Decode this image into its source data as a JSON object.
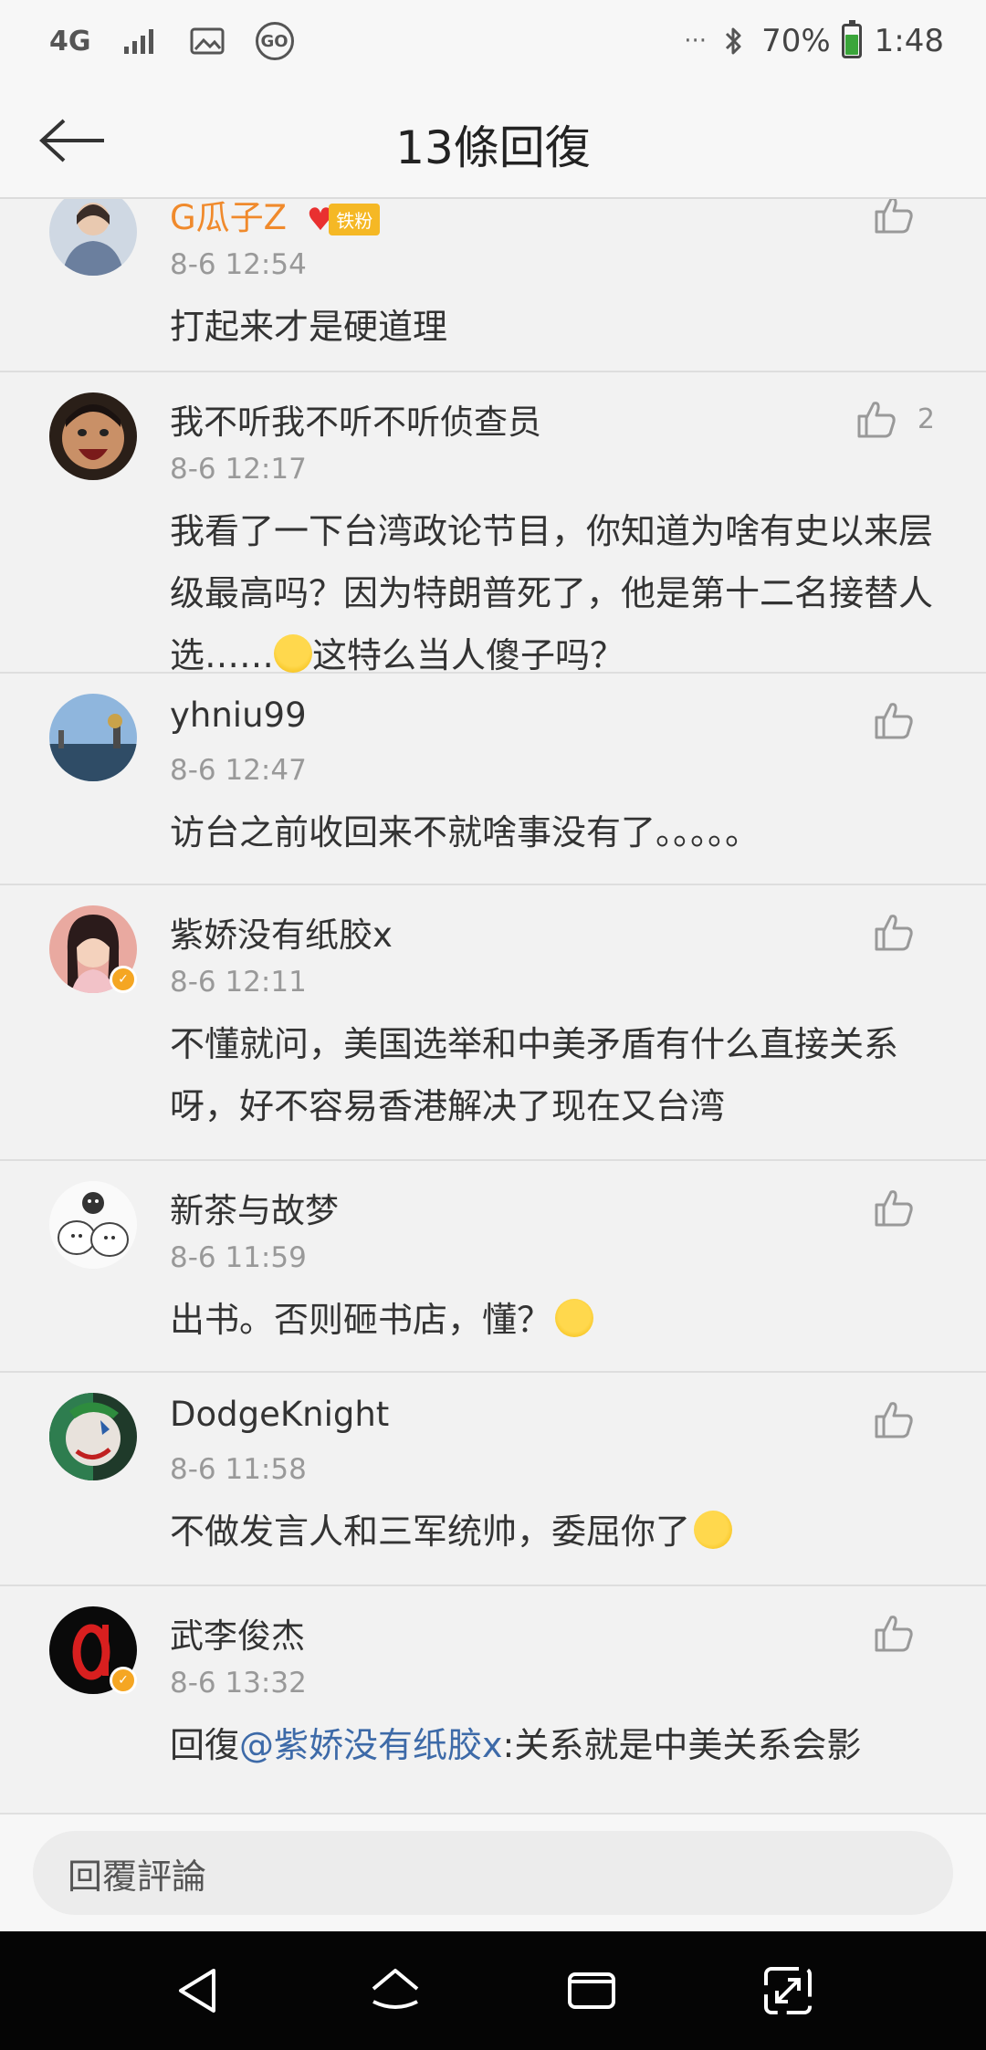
{
  "status_bar": {
    "network": "4G",
    "battery_text": "70%",
    "battery_level": 0.7,
    "time": "1:48",
    "more": "···"
  },
  "header": {
    "title": "13條回復"
  },
  "comments": [
    {
      "username": "G瓜子Z",
      "fan_label": "铁粉",
      "time": "8-6 12:54",
      "text": "打起来才是硬道理",
      "likes": ""
    },
    {
      "username": "我不听我不听不听侦查员",
      "time": "8-6 12:17",
      "text_before": "我看了一下台湾政论节目，你知道为啥有史以来层级最高吗？因为特朗普死了，他是第十二名接替人选……",
      "text_after": "这特么当人傻子吗？",
      "likes": "2"
    },
    {
      "username": "yhniu99",
      "time": "8-6 12:47",
      "text": "访台之前收回来不就啥事没有了。。。。。",
      "likes": ""
    },
    {
      "username": "紫娇没有纸胶x",
      "time": "8-6 12:11",
      "text": "不懂就问，美国选举和中美矛盾有什么直接关系呀，好不容易香港解决了现在又台湾",
      "likes": ""
    },
    {
      "username": "新茶与故梦",
      "time": "8-6 11:59",
      "text": "出书。否则砸书店，懂？",
      "likes": ""
    },
    {
      "username": "DodgeKnight",
      "time": "8-6 11:58",
      "text": "不做发言人和三军统帅，委屈你了",
      "likes": ""
    },
    {
      "username": "武李俊杰",
      "time": "8-6 13:32",
      "reply_prefix": "回復",
      "mention": "@紫娇没有纸胶x",
      "text": ":关系就是中美关系会影",
      "likes": ""
    }
  ],
  "reply_bar": {
    "placeholder": "回覆評論"
  },
  "colors": {
    "background": "#f2f2f2",
    "bar": "#f7f7f7",
    "username_highlight": "#f08a2c",
    "mention": "#3d6aa8",
    "meta": "#999999",
    "nav_bar": "#050505",
    "verified_badge": "#f5a623"
  },
  "icons": {
    "back": "arrow-left-icon",
    "like": "thumbs-up-icon",
    "nav_back": "triangle-back-icon",
    "nav_home": "home-icon",
    "nav_recent": "recent-apps-icon",
    "nav_expand": "expand-icon"
  }
}
